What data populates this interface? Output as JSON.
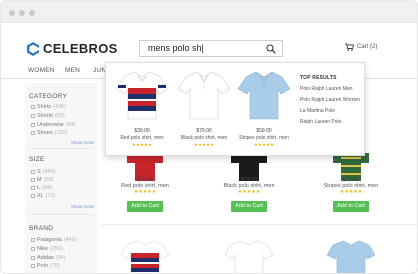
{
  "brand": {
    "name": "CELEBROS",
    "color": "#24272e",
    "accent": "#2a7dc4"
  },
  "search": {
    "value": "mens polo sh|",
    "placeholder": ""
  },
  "cart": {
    "label": "Cart",
    "count": "(2)"
  },
  "nav": [
    "WOMEN",
    "MEN",
    "JUNIORS"
  ],
  "sidebar": {
    "category": {
      "title": "CATEGORY",
      "items": [
        {
          "label": "Shirts",
          "count": "(445)"
        },
        {
          "label": "Shorts",
          "count": "(59)"
        },
        {
          "label": "Underwear",
          "count": "(84)"
        },
        {
          "label": "Shoes",
          "count": "(116)"
        }
      ],
      "more": "Show more"
    },
    "size": {
      "title": "SIZE",
      "items": [
        {
          "label": "S",
          "count": "(440)"
        },
        {
          "label": "M",
          "count": "(58)"
        },
        {
          "label": "L",
          "count": "(94)"
        },
        {
          "label": "XL",
          "count": "(70)"
        }
      ],
      "more": "Show more"
    },
    "brand": {
      "title": "BRAND",
      "items": [
        {
          "label": "Patagonia",
          "count": "(440)"
        },
        {
          "label": "Nike",
          "count": "(250)"
        },
        {
          "label": "Adidas",
          "count": "(94)"
        },
        {
          "label": "Polo",
          "count": "(70)"
        }
      ]
    }
  },
  "products_row1": [
    {
      "price": "$39.00",
      "name": "Red polo shirt, men",
      "stars": "★★★★★",
      "button": "Add to Cart"
    },
    {
      "price": "$79.00",
      "name": "Black polo shirt, men",
      "stars": "★★★★★",
      "button": "Add to Cart"
    },
    {
      "price": "$59.00",
      "name": "Stripes polo shirt, men",
      "stars": "★★★★★",
      "button": "Add to Cart"
    }
  ],
  "dropdown": {
    "products": [
      {
        "price": "$39.00",
        "name": "Red polo shirt, men",
        "stars": "★★★★★"
      },
      {
        "price": "$79.00",
        "name": "Black polo shirt, men",
        "stars": "★★★★★"
      },
      {
        "price": "$59.00",
        "name": "Stripes polo shirt, men",
        "stars": "★★★★★"
      }
    ],
    "results_title": "TOP RESULTS",
    "results": [
      "Polo Ralph Lauren Men",
      "Polo Ralph Lauren Women",
      "La Martina Polo",
      "Ralph Lauren Polo"
    ]
  },
  "colors": {
    "add_to_cart": "#55c155",
    "stars": "#f0b400",
    "link": "#6b8fc4"
  }
}
